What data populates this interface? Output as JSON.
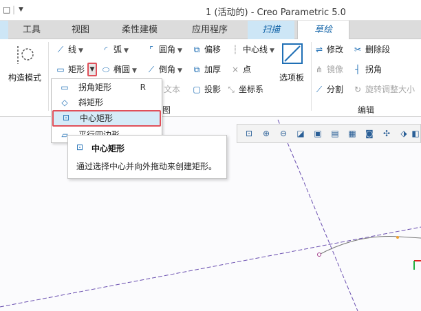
{
  "titlebar": {
    "qa_button_a": "□",
    "qa_separator": "|",
    "qa_button_b": "▼",
    "title": "1 (活动的) - Creo Parametric 5.0"
  },
  "tabs": [
    {
      "label": "工具"
    },
    {
      "label": "视图"
    },
    {
      "label": "柔性建模"
    },
    {
      "label": "应用程序"
    },
    {
      "label": "扫描"
    },
    {
      "label": "草绘"
    }
  ],
  "ribbon": {
    "construction_mode": "构造模式",
    "line": "线",
    "arc": "弧",
    "fillet": "圆角",
    "offset": "偏移",
    "centerline": "中心线",
    "rectangle": "矩形",
    "ellipse": "椭圆",
    "chamfer": "倒角",
    "thicken": "加厚",
    "point": "点",
    "text": "文本",
    "project": "投影",
    "coord_system": "坐标系",
    "palette": "选项板",
    "modify": "修改",
    "delete_segment": "删除段",
    "mirror": "镜像",
    "corner": "拐角",
    "divide": "分割",
    "rotate_resize": "旋转调整大小",
    "edit_group": "编辑",
    "sketch_group_partial": "图"
  },
  "menu": {
    "items": [
      {
        "label": "拐角矩形",
        "key": "R"
      },
      {
        "label": "斜矩形",
        "key": ""
      },
      {
        "label": "中心矩形",
        "key": ""
      },
      {
        "label": "平行四边形",
        "key": ""
      }
    ]
  },
  "tooltip": {
    "title": "中心矩形",
    "description": "通过选择中心并向外拖动来创建矩形。"
  },
  "colors": {
    "accent": "#1f6fb5",
    "highlight_border": "#e0505a",
    "centerline": "#6a4fb0",
    "tab_blue": "#cde6f6"
  },
  "icons": {
    "zoom_fit": "zoom-fit-icon",
    "zoom_in": "zoom-in-icon",
    "zoom_out": "zoom-out-icon",
    "repaint": "repaint-icon",
    "shading": "shading-icon",
    "saved_views": "saved-views-icon",
    "sketch_view": "sketch-view-icon",
    "display_style": "display-style-icon",
    "datum_display": "datum-display-icon",
    "spin_center": "spin-center-icon",
    "box": "box-icon"
  }
}
